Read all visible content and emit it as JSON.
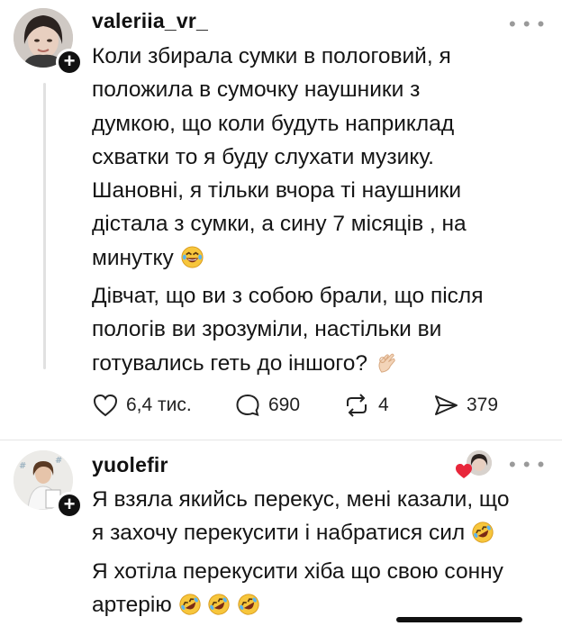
{
  "post": {
    "username": "valeriia_vr_",
    "lines": [
      "Коли збирала сумки в пологовий, я",
      "положила в сумочку наушники з",
      "думкою, що коли будуть наприклад",
      "схватки то  я буду слухати музику.",
      "Шановні, я тільки вчора ті наушники",
      "дістала з сумки, а сину 7 місяців , на",
      "минутку",
      "Дівчат, що ви з собою брали, що після",
      "пологів ви зрозуміли, настільки ви",
      "готувались геть до іншого?"
    ],
    "likes": "6,4 тис.",
    "comments": "690",
    "reposts": "4",
    "shares": "379"
  },
  "reply": {
    "username": "yuolefir",
    "lines": [
      "Я взяла якийсь перекус, мені казали, що",
      "я захочу перекусити і набратися сил",
      "Я хотіла перекусити хіба що свою сонну",
      "артерію"
    ]
  },
  "icons": {
    "more": "more-dots-icon",
    "like": "heart-icon",
    "comment": "speech-bubble-icon",
    "repost": "repost-icon",
    "share": "send-icon",
    "laugh_emoji": "laughing-emoji-icon",
    "rofl_emoji": "rolling-on-floor-laughing-emoji-icon",
    "ok_hand_emoji": "ok-hand-emoji-icon"
  },
  "more_label": "• • •",
  "plus_label": "+"
}
